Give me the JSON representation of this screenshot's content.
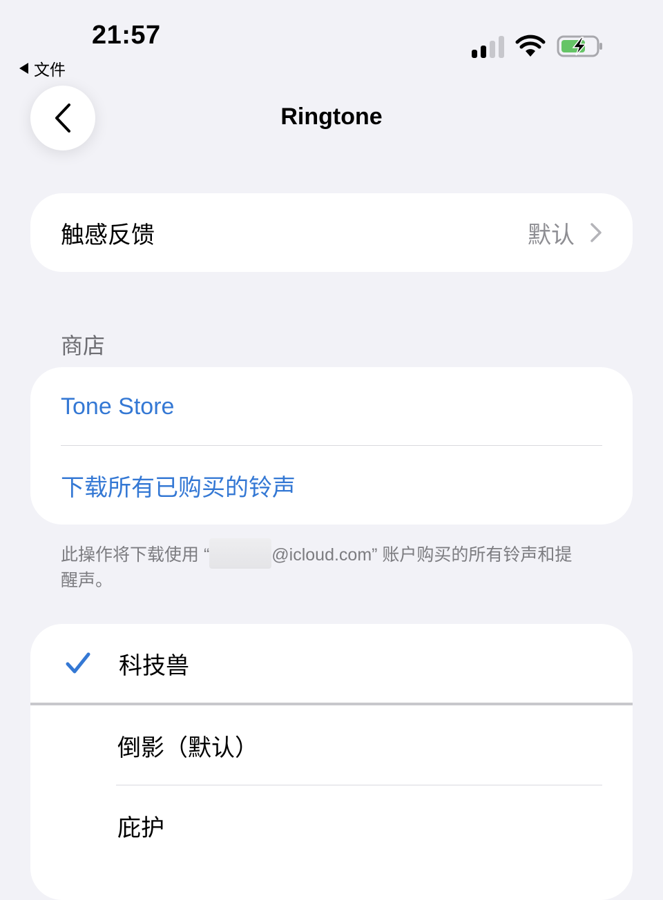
{
  "status_bar": {
    "time": "21:57",
    "back_app_label": "文件"
  },
  "nav": {
    "title": "Ringtone"
  },
  "haptics": {
    "label": "触感反馈",
    "value": "默认"
  },
  "store": {
    "section_label": "商店",
    "items": [
      {
        "label": "Tone Store"
      },
      {
        "label": "下载所有已购买的铃声"
      }
    ],
    "footnote_prefix": "此操作将下载使用 “",
    "footnote_suffix": "@icloud.com” 账户购买的所有铃声和提醒声。"
  },
  "ringtones": {
    "items": [
      {
        "label": "科技兽",
        "selected": true
      },
      {
        "label": "倒影（默认）",
        "selected": false
      },
      {
        "label": "庇护",
        "selected": false
      }
    ]
  },
  "colors": {
    "accent": "#3478d4",
    "background": "#f2f2f7",
    "battery_fill": "#65c466"
  }
}
